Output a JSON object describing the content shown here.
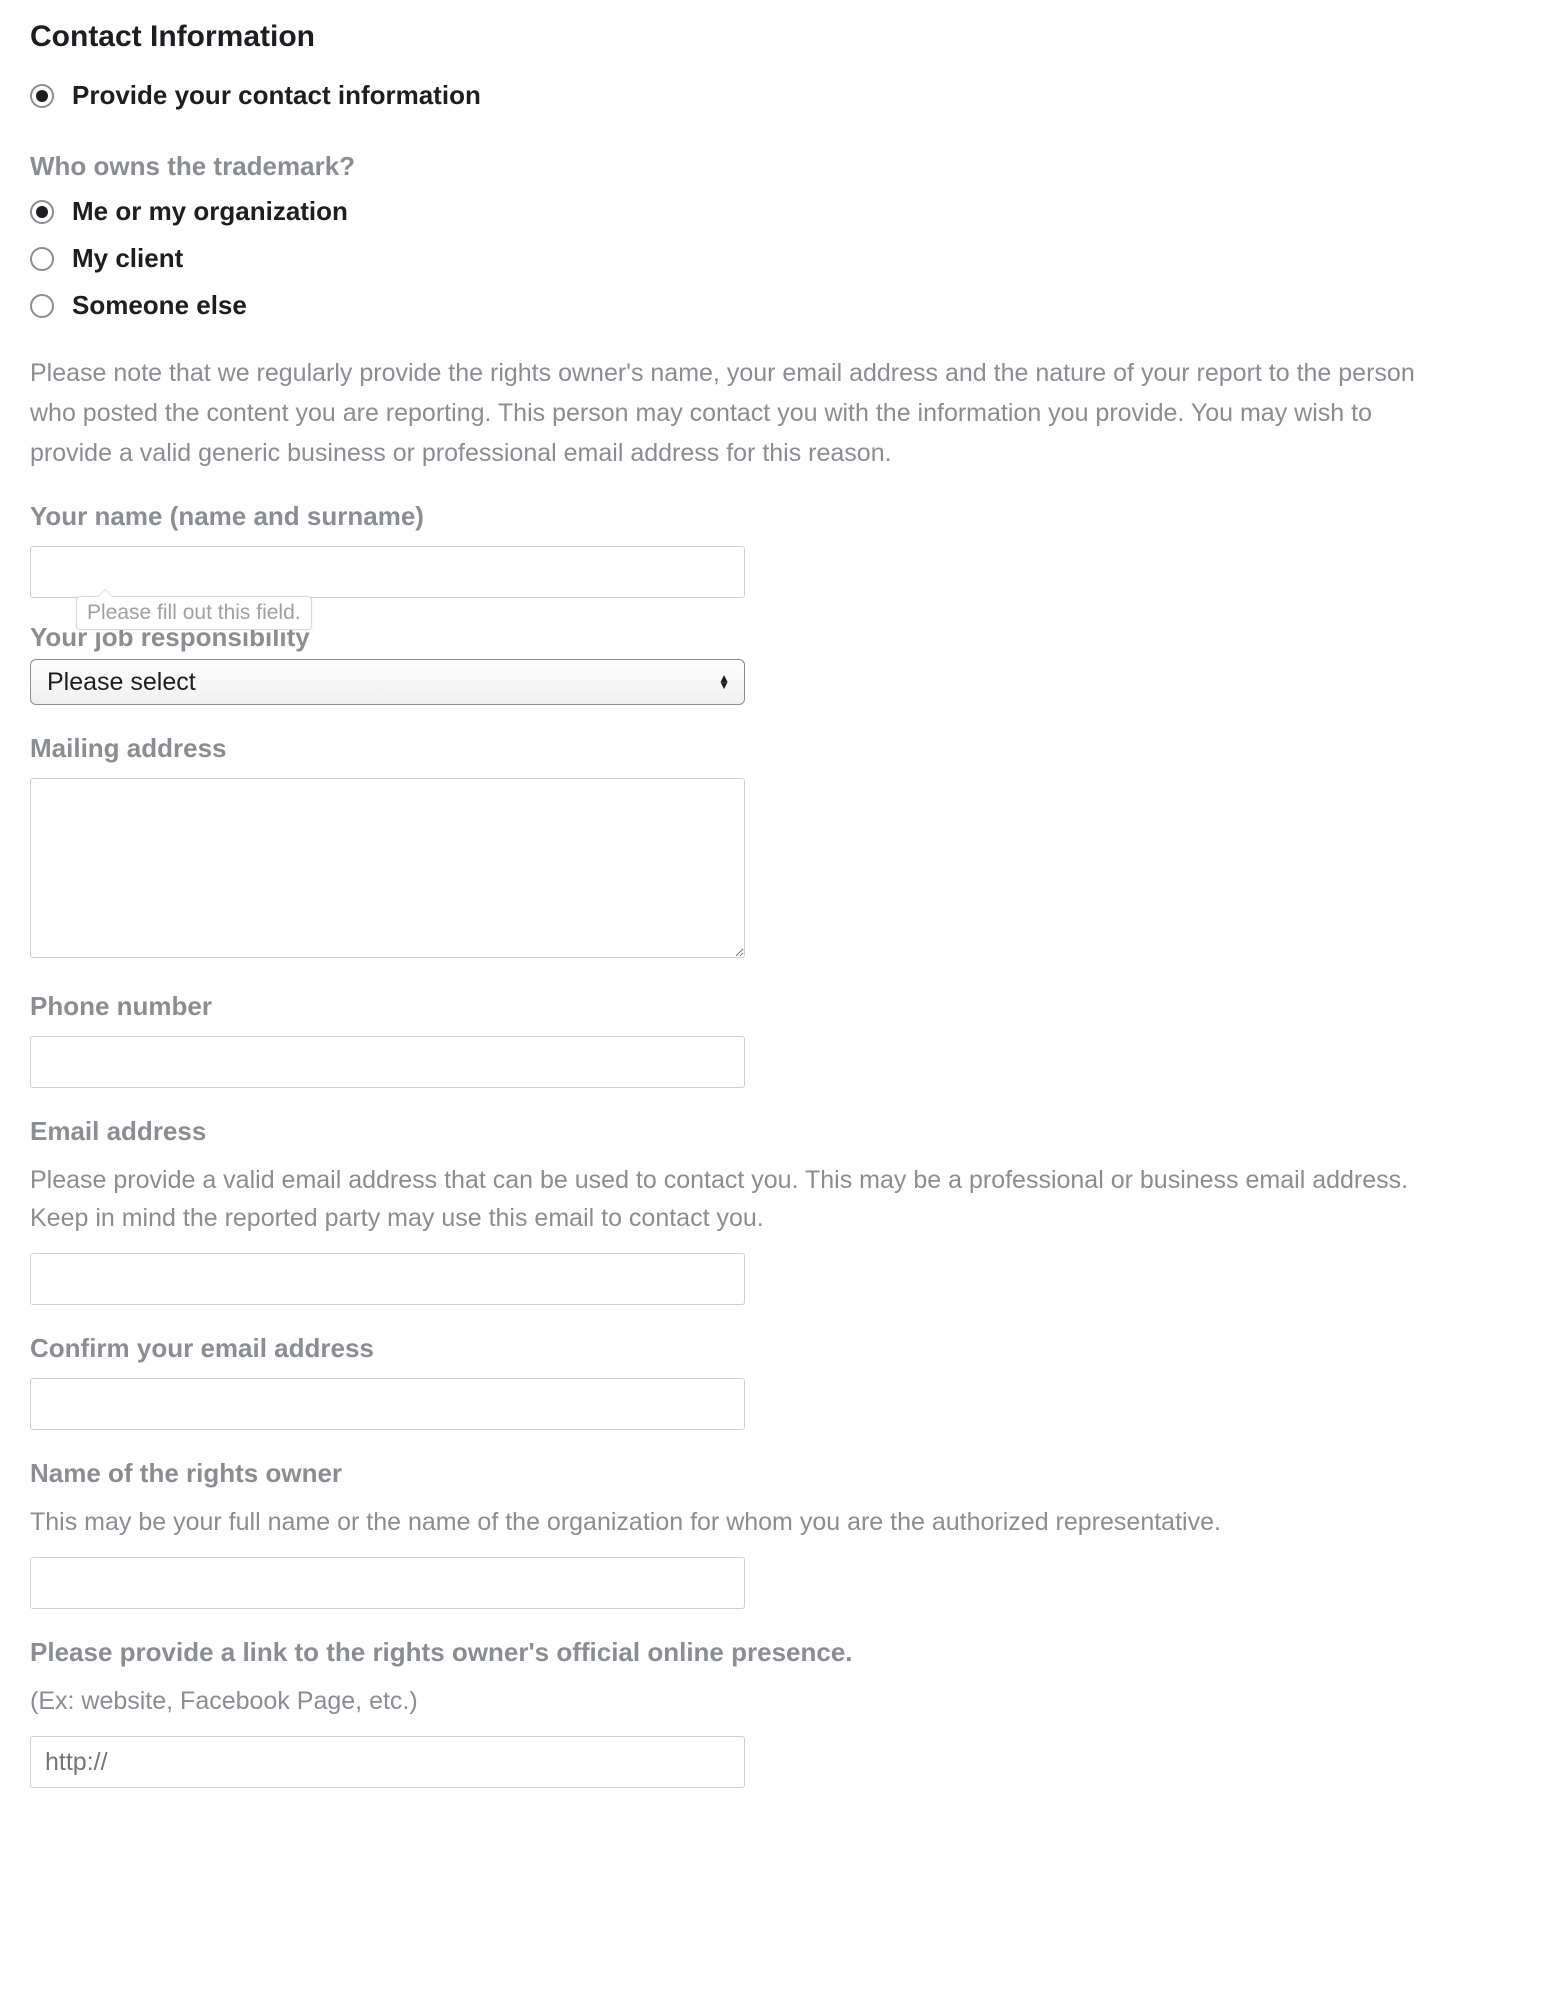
{
  "heading": "Contact Information",
  "contact_option": {
    "label": "Provide your contact information",
    "checked": true
  },
  "owner_question": "Who owns the trademark?",
  "owner_options": [
    {
      "label": "Me or my organization",
      "checked": true
    },
    {
      "label": "My client",
      "checked": false
    },
    {
      "label": "Someone else",
      "checked": false
    }
  ],
  "disclosure": "Please note that we regularly provide the rights owner's name, your email address and the nature of your report to the person who posted the content you are reporting. This person may contact you with the information you provide. You may wish to provide a valid generic business or professional email address for this reason.",
  "name_label": "Your name (name and surname)",
  "tooltip_text": "Please fill out this field.",
  "job_label": "Your job responsibility",
  "job_select_value": "Please select",
  "mailing_label": "Mailing address",
  "phone_label": "Phone number",
  "email_label": "Email address",
  "email_helper": "Please provide a valid email address that can be used to contact you. This may be a professional or business email address. Keep in mind the reported party may use this email to contact you.",
  "confirm_email_label": "Confirm your email address",
  "rights_owner_label": "Name of the rights owner",
  "rights_owner_helper": "This may be your full name or the name of the organization for whom you are the authorized representative.",
  "link_label": "Please provide a link to the rights owner's official online presence.",
  "link_helper": "(Ex: website, Facebook Page, etc.)",
  "link_placeholder": "http://"
}
